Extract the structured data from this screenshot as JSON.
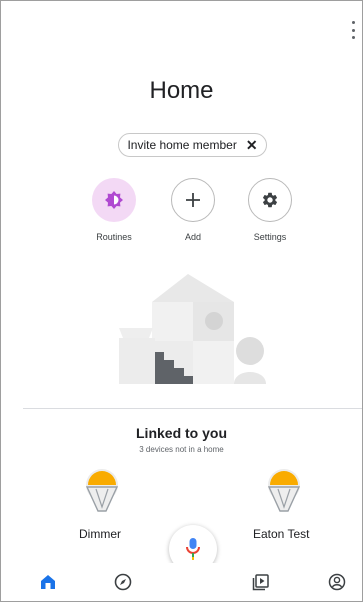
{
  "header": {
    "title": "Home"
  },
  "invite_chip": {
    "label": "Invite home member",
    "close_symbol": "✕"
  },
  "actions": [
    {
      "label": "Routines",
      "icon": "routines-icon"
    },
    {
      "label": "Add",
      "icon": "plus-icon"
    },
    {
      "label": "Settings",
      "icon": "gear-icon"
    }
  ],
  "linked": {
    "title": "Linked to you",
    "subtitle": "3 devices not in a home",
    "devices": [
      {
        "name": "Dimmer",
        "icon": "light-bulb-icon"
      },
      {
        "name": "Eaton Test",
        "icon": "light-bulb-icon"
      }
    ]
  },
  "bottom_nav": [
    {
      "name": "home-tab",
      "icon": "home-icon"
    },
    {
      "name": "discover-tab",
      "icon": "compass-icon"
    },
    {
      "name": "media-tab",
      "icon": "media-icon"
    },
    {
      "name": "account-tab",
      "icon": "account-icon"
    }
  ],
  "colors": {
    "accent_blue": "#1a73e8",
    "routines_purple": "#b04ad1",
    "routines_bg": "#f3d9f5",
    "bulb_yellow": "#f9ab00"
  }
}
